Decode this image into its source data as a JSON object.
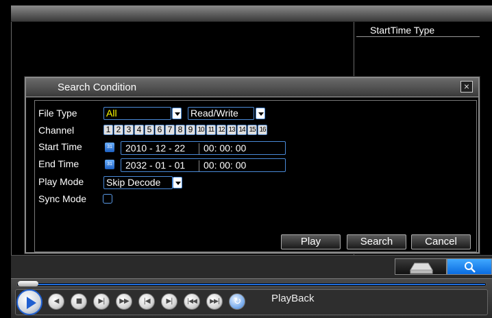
{
  "right_panel": {
    "column_header": "StartTime Type"
  },
  "dialog": {
    "title": "Search Condition",
    "close_glyph": "×",
    "labels": {
      "file_type": "File Type",
      "channel": "Channel",
      "start_time": "Start Time",
      "end_time": "End Time",
      "play_mode": "Play Mode",
      "sync_mode": "Sync Mode"
    },
    "file_type": {
      "value": "All",
      "value_color": "#ffff00"
    },
    "access": {
      "value": "Read/Write"
    },
    "channels": [
      "1",
      "2",
      "3",
      "4",
      "5",
      "6",
      "7",
      "8",
      "9",
      "10",
      "11",
      "12",
      "13",
      "14",
      "15",
      "16"
    ],
    "start_time": {
      "date": "2010 - 12 - 22",
      "time": "00: 00: 00"
    },
    "end_time": {
      "date": "2032 - 01 - 01",
      "time": "00: 00: 00"
    },
    "play_mode": {
      "value": "Skip Decode"
    },
    "sync_mode": {
      "checked": false
    },
    "buttons": {
      "play": "Play",
      "search": "Search",
      "cancel": "Cancel"
    }
  },
  "side_buttons": {
    "hdd_icon": "hdd-icon",
    "search_icon": "magnifier-icon"
  },
  "playback": {
    "label": "PlayBack",
    "progress_percent": 0,
    "controls": [
      "prev",
      "stop",
      "slow",
      "fast",
      "prev-frame",
      "next-frame",
      "skip-back",
      "skip-forward",
      "sync"
    ],
    "icon_glyphs": {
      "prev": "◀",
      "stop": "■",
      "slow": "▶|",
      "fast": "▶▶",
      "prev_frame": "|◀",
      "next_frame": "▶|",
      "skip_back": "|◀◀",
      "skip_forward": "▶▶|",
      "sync": "↻"
    }
  },
  "colors": {
    "accent": "#1f5fd0",
    "highlight": "#0a6be0"
  }
}
